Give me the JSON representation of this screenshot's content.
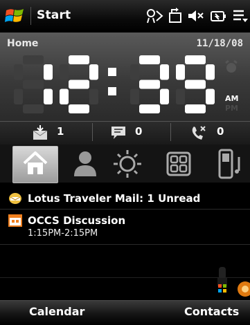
{
  "titlebar": {
    "start_label": "Start"
  },
  "home": {
    "label": "Home",
    "date": "11/18/08",
    "time": "12:39",
    "am": "AM",
    "pm": "PM"
  },
  "counters": {
    "email": "1",
    "messages": "0",
    "missed_calls": "0"
  },
  "tabs": [
    "home-tab",
    "people-tab",
    "weather-tab",
    "apps-tab",
    "phone-tab"
  ],
  "list": {
    "mail": "Lotus Traveler Mail: 1 Unread",
    "appointment_title": "OCCS Discussion",
    "appointment_time": "1:15PM-2:15PM"
  },
  "softkeys": {
    "left": "Calendar",
    "right": "Contacts"
  },
  "colors": {
    "selected_tab": "#c8c8c8",
    "background": "#000000",
    "panel": "#3a3a3a"
  }
}
